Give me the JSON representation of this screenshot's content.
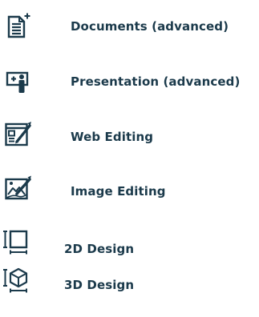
{
  "menu": {
    "items": [
      {
        "label": "Documents (advanced)",
        "icon": "document-plus-icon"
      },
      {
        "label": "Presentation (advanced)",
        "icon": "presentation-icon"
      },
      {
        "label": "Web Editing",
        "icon": "web-editing-icon"
      },
      {
        "label": "Image Editing",
        "icon": "image-editing-icon"
      },
      {
        "label": "2D Design",
        "icon": "2d-design-icon"
      },
      {
        "label": "3D Design",
        "icon": "3d-design-icon"
      }
    ]
  },
  "colors": {
    "text": "#1b3a4b",
    "icon": "#1b3a4b"
  }
}
